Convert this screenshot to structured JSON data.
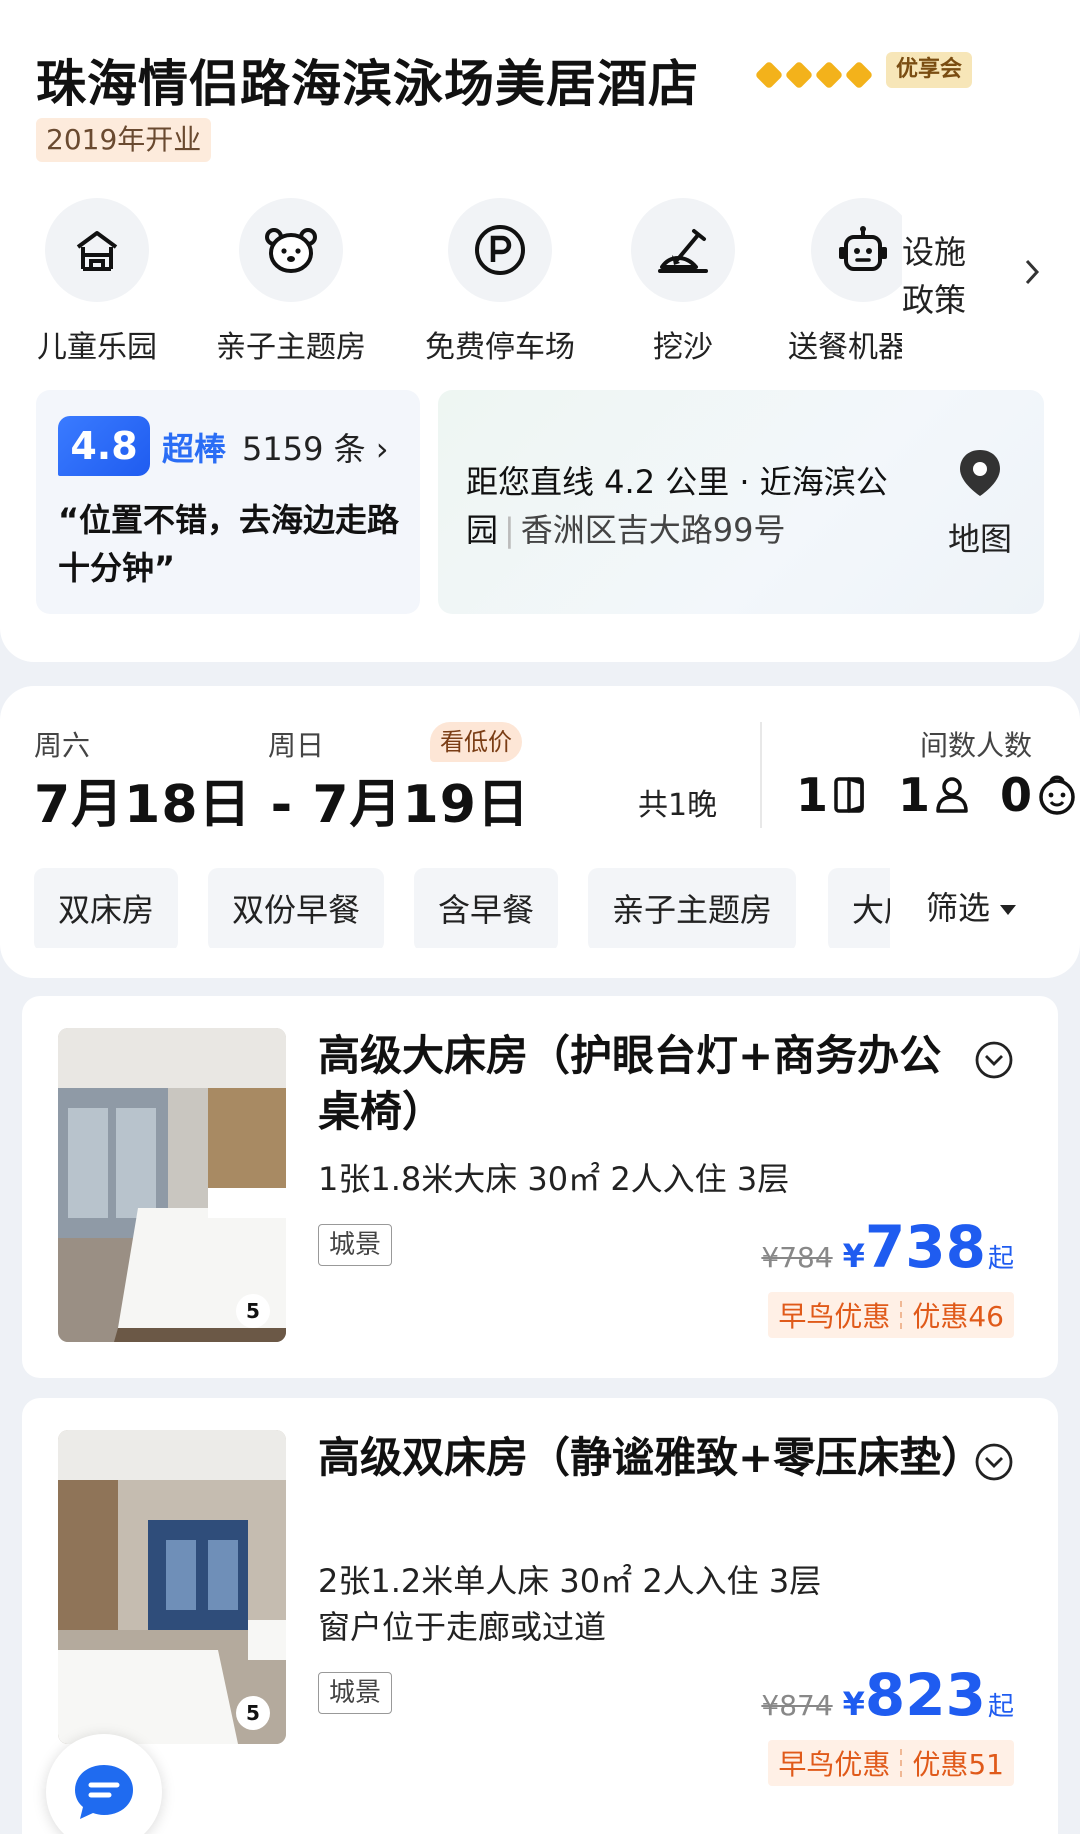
{
  "hotel": {
    "name": "珠海情侣路海滨泳场美居酒店",
    "member_badge": "优享会",
    "opening": "2019年开业"
  },
  "facilities": [
    {
      "label": "儿童乐园",
      "icon": "playground-icon"
    },
    {
      "label": "亲子主题房",
      "icon": "bear-icon"
    },
    {
      "label": "免费停车场",
      "icon": "parking-icon"
    },
    {
      "label": "挖沙",
      "icon": "shovel-icon"
    },
    {
      "label": "送餐机器人",
      "icon": "robot-icon"
    }
  ],
  "policy_link": {
    "line1": "设施",
    "line2": "政策"
  },
  "rating": {
    "score": "4.8",
    "word": "超棒",
    "count": "5159 条 ›",
    "quote": "“位置不错，去海边走路十分钟”"
  },
  "location": {
    "distance": "距您直线 4.2 公里 · 近海滨公园",
    "separator": "|",
    "address": "香洲区吉大路99号",
    "map_label": "地图"
  },
  "booking": {
    "checkin_weekday": "周六",
    "checkout_weekday": "周日",
    "date_range": "7月18日 - 7月19日",
    "low_price_badge": "看低价",
    "nights": "共1晚",
    "guests_label": "间数人数",
    "rooms": "1",
    "adults": "1",
    "children": "0"
  },
  "filters": {
    "chips": [
      "双床房",
      "双份早餐",
      "含早餐",
      "亲子主题房",
      "大床房"
    ],
    "filter_label": "筛选"
  },
  "rooms": [
    {
      "name": "高级大床房（护眼台灯+商务办公桌椅）",
      "spec": "1张1.8米大床  30㎡  2人入住  3层",
      "extra": "",
      "view": "城景",
      "photo_count": "5",
      "old_price": "¥784",
      "yen": "¥",
      "price": "738",
      "from": "起",
      "promo1": "早鸟优惠",
      "promo2": "优惠46"
    },
    {
      "name": "高级双床房（静谧雅致+零压床垫）",
      "spec": "2张1.2米单人床  30㎡  2人入住  3层",
      "extra": "窗户位于走廊或过道",
      "view": "城景",
      "photo_count": "5",
      "old_price": "¥874",
      "yen": "¥",
      "price": "823",
      "from": "起",
      "promo1": "早鸟优惠",
      "promo2": "优惠51"
    }
  ],
  "colors": {
    "accent_blue": "#1f5cf0",
    "star_gold": "#f3b21b",
    "promo_orange": "#e05a1a"
  }
}
